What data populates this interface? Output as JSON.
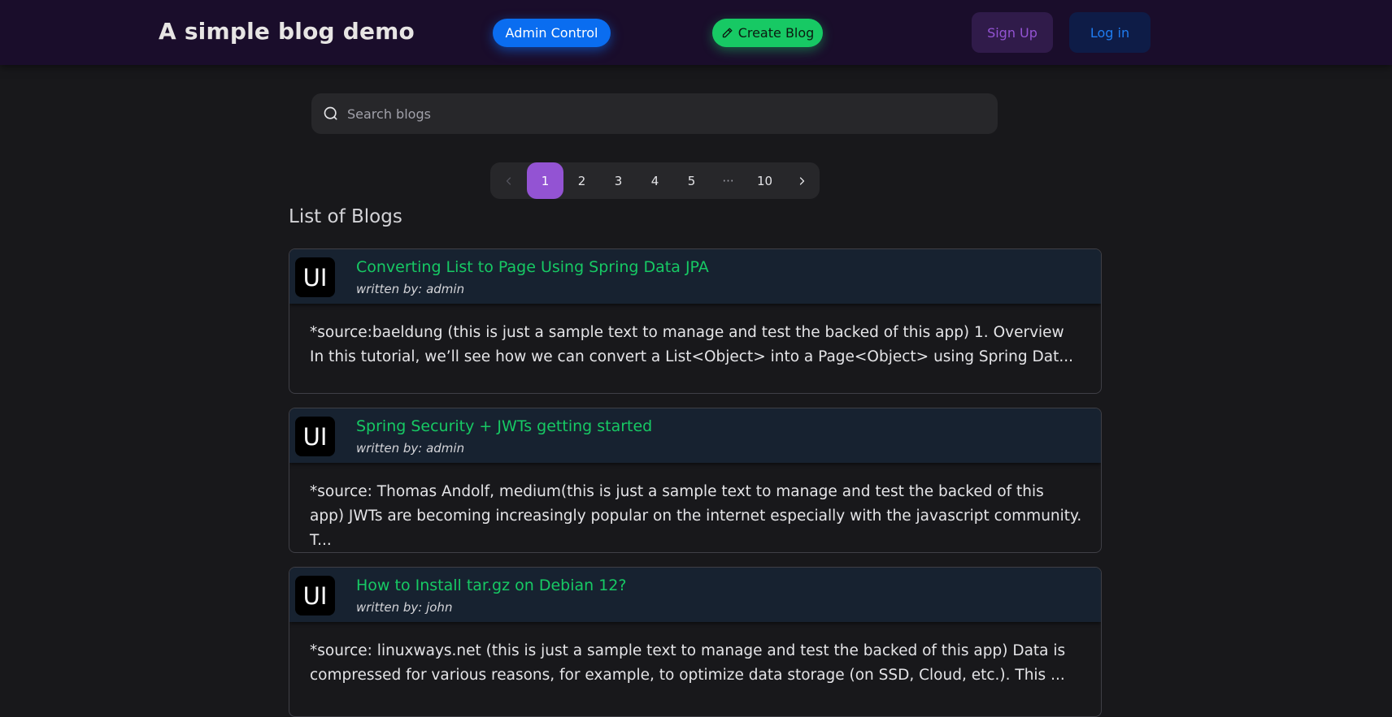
{
  "header": {
    "brand": "A simple blog demo",
    "admin_label": "Admin Control",
    "create_label": "Create Blog",
    "signup_label": "Sign Up",
    "login_label": "Log in"
  },
  "search": {
    "placeholder": "Search blogs",
    "icon": "search-icon"
  },
  "pagination": {
    "prev_icon": "chevron-left-icon",
    "next_icon": "chevron-right-icon",
    "pages": [
      "1",
      "2",
      "3",
      "4",
      "5",
      "···",
      "10"
    ],
    "current": "1"
  },
  "main": {
    "list_title": "List of Blogs",
    "blogs": [
      {
        "avatar": "UI",
        "title": "Converting List to Page Using Spring Data JPA",
        "author": "written by: admin",
        "excerpt": "*source:baeldung (this is just a sample text to manage and test the backed of this app) 1. Overview In this tutorial, we’ll see how we can convert a List<Object> into a Page<Object> using Spring Dat..."
      },
      {
        "avatar": "UI",
        "title": "Spring Security + JWTs getting started",
        "author": "written by: admin",
        "excerpt": "*source: Thomas Andolf, medium(this is just a sample text to manage and test the backed of this app) JWTs are becoming increasingly popular on the internet especially with the javascript community. T..."
      },
      {
        "avatar": "UI",
        "title": "How to Install tar.gz on Debian 12?",
        "author": "written by: john",
        "excerpt": "*source: linuxways.net (this is just a sample text to manage and test the backed of this app) Data is compressed for various reasons, for example, to optimize data storage (on SSD, Cloud, etc.). This ..."
      }
    ]
  },
  "colors": {
    "navbar_bg": "#1a0d2b",
    "page_bg": "#18181b",
    "primary": "#0a6df0",
    "success": "#17c964",
    "secondary": "#9353d3",
    "card_header_bg": "#172230"
  }
}
